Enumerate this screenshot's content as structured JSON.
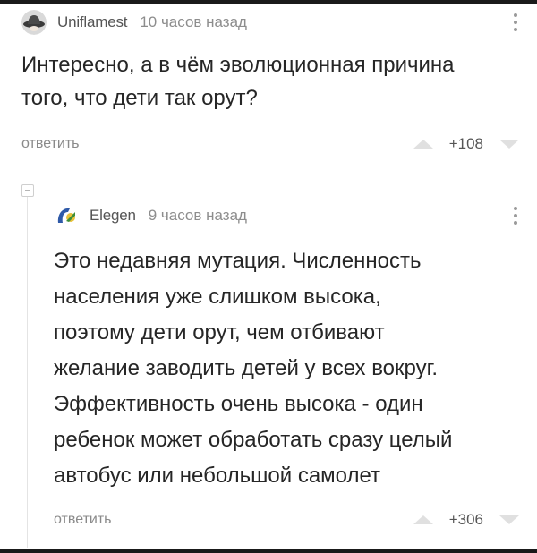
{
  "comments": [
    {
      "author": "Uniflamest",
      "time": "10 часов назад",
      "text": "Интересно, а в чём эволюционная причина\nтого, что дети так орут?",
      "reply_label": "ответить",
      "rating": "+108"
    },
    {
      "author": "Elegen",
      "time": "9 часов назад",
      "text": "Это недавняя мутация. Численность\nнаселения уже слишком высока,\nпоэтому дети орут, чем отбивают\nжелание заводить детей у всех вокруг.\nЭффективность очень высока - один\nребенок может обработать сразу целый\nавтобус или небольшой самолет",
      "reply_label": "ответить",
      "rating": "+306"
    }
  ],
  "colors": {
    "vote_arrow": "#e0e0e0",
    "muted_text": "#8a8a8a"
  },
  "icons": {
    "avatar_1": "hat-avatar-icon",
    "avatar_2": "logo-avatar-icon",
    "menu": "more-vertical-icon",
    "upvote": "upvote-arrow-icon",
    "downvote": "downvote-arrow-icon",
    "collapse": "collapse-thread-icon"
  }
}
